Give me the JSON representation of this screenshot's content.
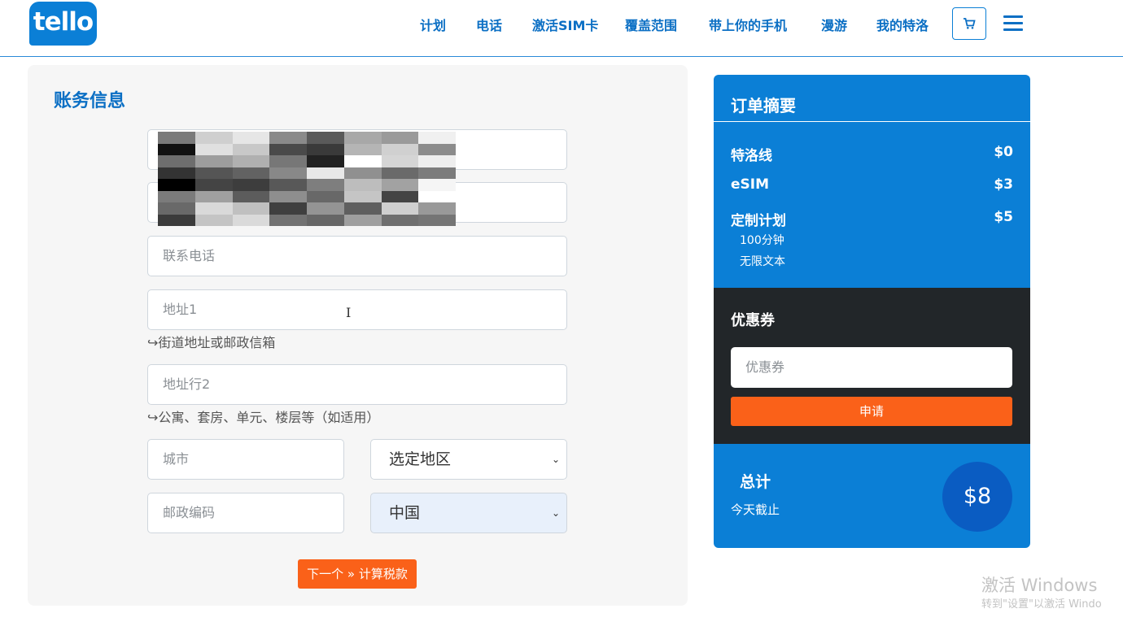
{
  "brand": {
    "logo_text": "tello",
    "color": "#0b7fd6"
  },
  "nav": {
    "items": [
      "计划",
      "电话",
      "激活SIM卡",
      "覆盖范围",
      "带上你的手机",
      "漫游",
      "我的特洛"
    ],
    "cart_icon": "cart-icon",
    "menu_icon": "hamburger-menu-icon"
  },
  "billing": {
    "title": "账务信息",
    "phone_placeholder": "联系电话",
    "address1_placeholder": "地址1",
    "address1_hint": "↪街道地址或邮政信箱",
    "address2_placeholder": "地址行2",
    "address2_hint": "↪公寓、套房、单元、楼层等（如适用）",
    "city_placeholder": "城市",
    "region_select": "选定地区",
    "zip_placeholder": "邮政编码",
    "country_select": "中国",
    "next_button": "下一个 » 计算税款"
  },
  "summary": {
    "title": "订单摘要",
    "lines": [
      {
        "label": "特洛线",
        "price": "$0"
      },
      {
        "label": "eSIM",
        "price": "$3"
      },
      {
        "label": "定制计划",
        "price": "$5"
      }
    ],
    "plan_details": [
      "100分钟",
      "无限文本"
    ],
    "coupon": {
      "title": "优惠券",
      "placeholder": "优惠券",
      "apply_button": "申请"
    },
    "total_label": "总计",
    "total_sub": "今天截止",
    "total_value": "$8"
  },
  "watermark": {
    "line1": "激活 Windows",
    "line2": "转到\"设置\"以激活 Windo"
  },
  "colors": {
    "accent": "#0b7fd6",
    "orange": "#fa6119",
    "dark": "#222629",
    "country_select_bg": "#e8f0fb"
  }
}
